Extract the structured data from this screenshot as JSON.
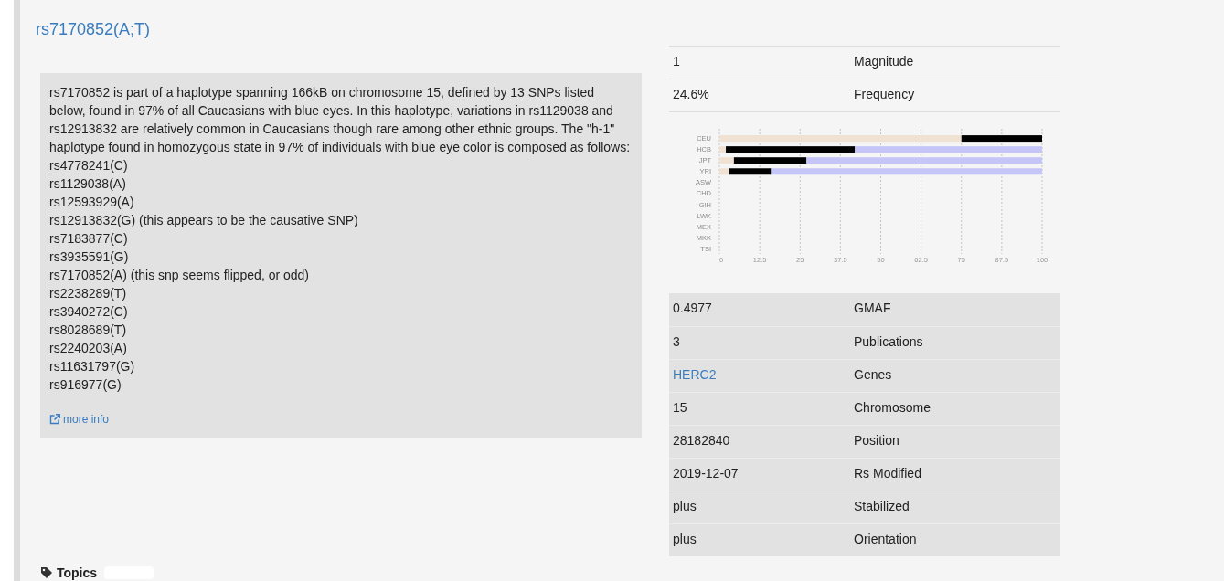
{
  "title": "rs7170852(A;T)",
  "description": {
    "text": "rs7170852 is part of a haplotype spanning 166kB on chromosome 15, defined by 13 SNPs listed below, found in 97% of all Caucasians with blue eyes. In this haplotype, variations in rs1129038 and rs12913832 are relatively common in Caucasians though rare among other ethnic groups. The \"h-1\" haplotype found in homozygous state in 97% of individuals with blue eye color is composed as follows:",
    "snps": [
      "rs4778241(C)",
      "rs1129038(A)",
      "rs12593929(A)",
      "rs12913832(G) (this appears to be the causative SNP)",
      "rs7183877(C)",
      "rs3935591(G)",
      "rs7170852(A) (this snp seems flipped, or odd)",
      "rs2238289(T)",
      "rs3940272(C)",
      "rs8028689(T)",
      "rs2240203(A)",
      "rs11631797(G)",
      "rs916977(G)"
    ],
    "link": "more info"
  },
  "summary_table": [
    {
      "value": "1",
      "label": "Magnitude"
    },
    {
      "value": "24.6%",
      "label": "Frequency"
    }
  ],
  "population_chart": {
    "chart_data": {
      "type": "bar",
      "orientation": "horizontal",
      "stacked": true,
      "grid": true,
      "categories": [
        "CEU",
        "HCB",
        "JPT",
        "YRI",
        "ASW",
        "CHD",
        "GIH",
        "LWK",
        "MEX",
        "MKK",
        "TSI"
      ],
      "series": [
        {
          "color": "#efe2d2",
          "values": [
            75,
            2,
            4.5,
            3,
            null,
            null,
            null,
            null,
            null,
            null,
            null
          ]
        },
        {
          "color": "#000000",
          "values": [
            25,
            40,
            22.5,
            13,
            null,
            null,
            null,
            null,
            null,
            null,
            null
          ]
        },
        {
          "color": "#c5c5f8",
          "values": [
            0,
            58,
            73,
            84,
            null,
            null,
            null,
            null,
            null,
            null,
            null
          ]
        }
      ],
      "xlim": [
        0,
        100
      ],
      "xticks": [
        0,
        12.5,
        25,
        37.5,
        50,
        62.5,
        75,
        87.5,
        100
      ]
    }
  },
  "details_table": [
    {
      "kind": "text",
      "value": "0.4977",
      "label": "GMAF"
    },
    {
      "kind": "text",
      "value": "3",
      "label": "Publications"
    },
    {
      "kind": "link",
      "value": "HERC2",
      "label": "Genes"
    },
    {
      "kind": "text",
      "value": "15",
      "label": "Chromosome"
    },
    {
      "kind": "text",
      "value": "28182840",
      "label": "Position"
    },
    {
      "kind": "text",
      "value": "2019-12-07",
      "label": "Rs Modified"
    },
    {
      "kind": "text",
      "value": "plus",
      "label": "Stabilized"
    },
    {
      "kind": "text",
      "value": "plus",
      "label": "Orientation"
    }
  ],
  "topics": {
    "heading": "Topics"
  }
}
